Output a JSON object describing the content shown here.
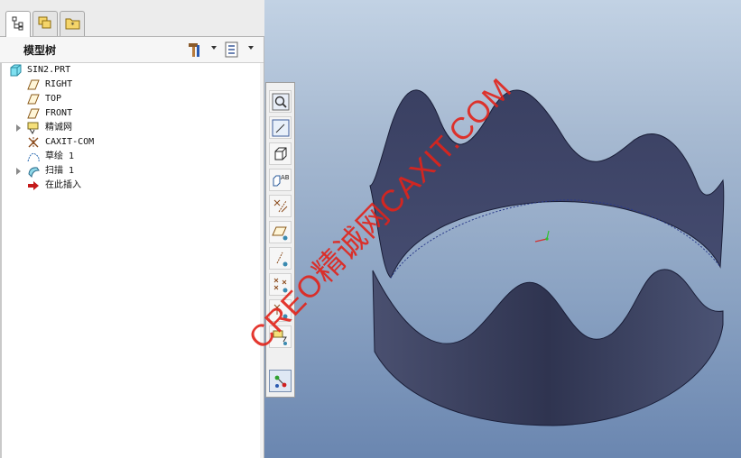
{
  "model_tree": {
    "title": "模型树",
    "items": [
      {
        "label": "SIN2.PRT",
        "icon": "part-icon"
      },
      {
        "label": "RIGHT",
        "icon": "datum-plane-icon"
      },
      {
        "label": "TOP",
        "icon": "datum-plane-icon"
      },
      {
        "label": "FRONT",
        "icon": "datum-plane-icon"
      },
      {
        "label": "精诚网",
        "icon": "layer-folder-icon"
      },
      {
        "label": "CAXIT-COM",
        "icon": "coordinate-system-icon"
      },
      {
        "label": "草绘 1",
        "icon": "sketch-icon"
      },
      {
        "label": "扫描 1",
        "icon": "sweep-feature-icon"
      },
      {
        "label": "在此插入",
        "icon": "insert-here-arrow-icon"
      }
    ]
  },
  "watermark": {
    "text": "CREO精诚网CAXIT.COM"
  },
  "colors": {
    "model": "#3c4262",
    "viewport_top": "#c2d2e4",
    "viewport_bottom": "#6a86b0",
    "watermark": "#e2231a"
  }
}
